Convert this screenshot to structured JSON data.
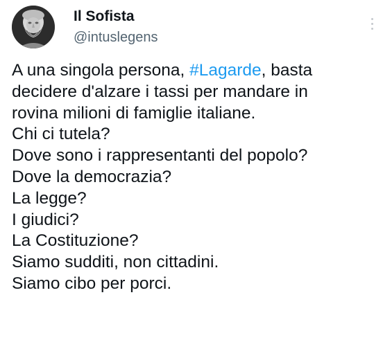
{
  "author": {
    "display_name": "Il Sofista",
    "handle": "@intuslegens",
    "avatar_icon": "greek-bust-avatar"
  },
  "menu": {
    "icon": "more-vertical-icon"
  },
  "tweet": {
    "line_1_before": "A una singola persona, ",
    "hashtag": "#Lagarde",
    "line_1_after": ", basta",
    "lines": [
      "decidere d'alzare i tassi per mandare in",
      "rovina milioni di famiglie italiane.",
      "Chi ci tutela?",
      "Dove sono i rappresentanti del popolo?",
      "Dove la democrazia?",
      "La legge?",
      "I giudici?",
      "La Costituzione?",
      "Siamo sudditi, non cittadini.",
      "Siamo cibo per porci."
    ]
  },
  "colors": {
    "text": "#0f1419",
    "secondary": "#536471",
    "link": "#1d9bf0"
  }
}
